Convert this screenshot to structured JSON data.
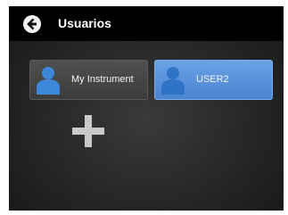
{
  "header": {
    "title": "Usuarios",
    "back_icon": "arrow-left-circle-icon"
  },
  "users": [
    {
      "label": "My Instrument",
      "icon": "user-avatar-icon",
      "selected": false
    },
    {
      "label": "USER2",
      "icon": "user-avatar-icon",
      "selected": true
    }
  ],
  "add_button": {
    "icon": "plus-icon"
  },
  "colors": {
    "title_bar": "#000000",
    "selected_tile": "#5a93dc",
    "unselected_tile": "#474747",
    "avatar_blue": "#3d88d8"
  }
}
